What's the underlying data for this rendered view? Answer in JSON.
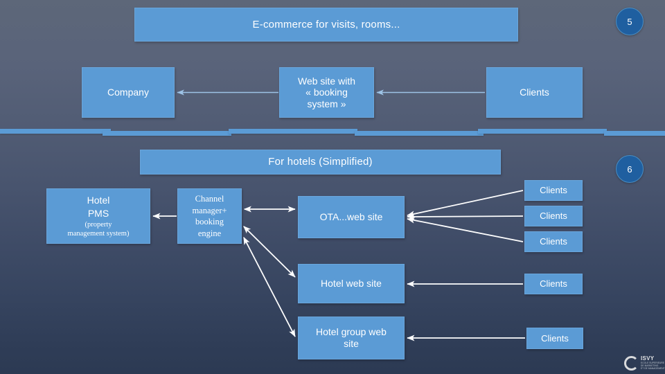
{
  "slide": {
    "background_top_color": "#5d6779",
    "background_bottom_color": "#2c3a53",
    "box_color": "#5b9bd5",
    "badge_color": "#1f5fa0",
    "arrow_color_light": "#9dc3e6",
    "arrow_color_white": "#ffffff"
  },
  "banners": {
    "ecommerce": "E-commerce for visits, rooms...",
    "hotels": "For hotels (Simplified)"
  },
  "badges": {
    "top": "5",
    "bottom": "6"
  },
  "section_top": {
    "company": "Company",
    "website_line1": "Web site with",
    "website_line2": "« booking",
    "website_line3": "system »",
    "clients": "Clients"
  },
  "section_hotels": {
    "hotel_pms_title_line1": "Hotel",
    "hotel_pms_title_line2": "PMS",
    "hotel_pms_sub_line1": "(property",
    "hotel_pms_sub_line2": "management system)",
    "channel_line1": "Channel",
    "channel_line2": "manager+",
    "channel_line3": "booking",
    "channel_line4": "engine",
    "ota": "OTA...web site",
    "hotel_web_site": "Hotel web site",
    "hotel_group_web_line1": "Hotel group web",
    "hotel_group_web_line2": "site",
    "clients_ota_1": "Clients",
    "clients_ota_2": "Clients",
    "clients_ota_3": "Clients",
    "clients_hotel_web": "Clients",
    "clients_hotel_group": "Clients"
  },
  "logo": {
    "mark": "ring-icon",
    "wordmark": "ISVY",
    "tagline_line1": "ECOLE SUPERIEURE",
    "tagline_line2": "DE MARKETING",
    "tagline_line3": "ET DE MANAGEMENT"
  }
}
